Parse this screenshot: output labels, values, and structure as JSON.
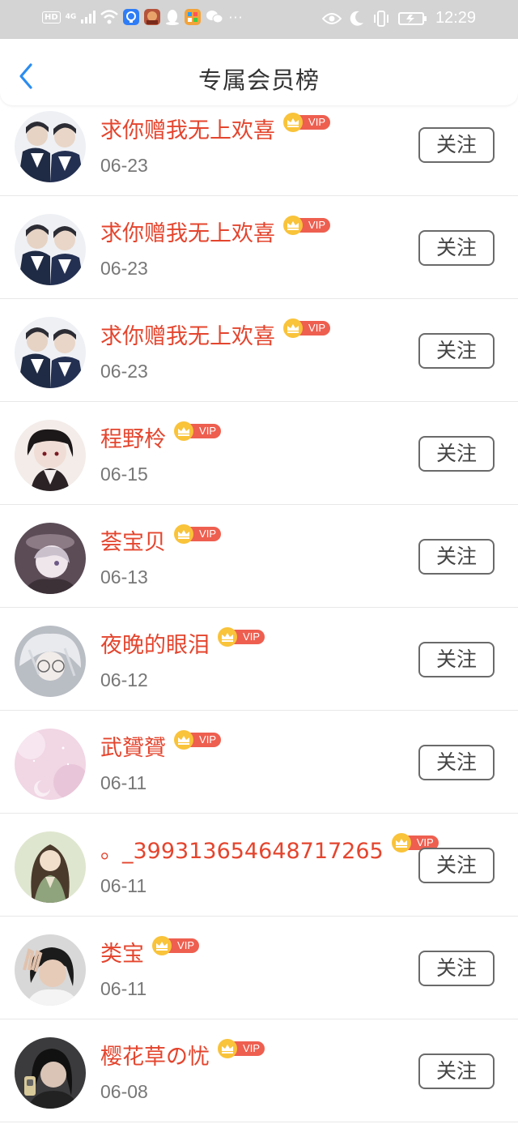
{
  "status_bar": {
    "network_badge": "HD",
    "network_type": "4G",
    "time": "12:29",
    "overflow": "···",
    "icons": [
      "signal-icon",
      "wifi-icon",
      "app-notification-icon",
      "game-app-icon",
      "qq-icon",
      "app-icon",
      "wechat-icon",
      "eye-icon",
      "moon-icon",
      "vibrate-icon",
      "battery-charging-icon"
    ]
  },
  "header": {
    "title": "专属会员榜",
    "back_icon": "chevron-left-icon",
    "accent_color": "#2a8cf0"
  },
  "badge": {
    "label": "VIP",
    "crown_color": "#f9c33a",
    "pill_color": "#ee5f50"
  },
  "colors": {
    "name": "#e4452e",
    "date": "#777777",
    "button_border": "#6a6a6a"
  },
  "members": [
    {
      "name": "求你赠我无上欢喜",
      "date": "06-23",
      "follow_label": "关注",
      "avatar": "avatar-two-boys"
    },
    {
      "name": "求你赠我无上欢喜",
      "date": "06-23",
      "follow_label": "关注",
      "avatar": "avatar-two-boys"
    },
    {
      "name": "求你赠我无上欢喜",
      "date": "06-23",
      "follow_label": "关注",
      "avatar": "avatar-two-boys"
    },
    {
      "name": "程野柃",
      "date": "06-15",
      "follow_label": "关注",
      "avatar": "avatar-dark-anime"
    },
    {
      "name": "荟宝贝",
      "date": "06-13",
      "follow_label": "关注",
      "avatar": "avatar-anime-hat"
    },
    {
      "name": "夜晚的眼泪",
      "date": "06-12",
      "follow_label": "关注",
      "avatar": "avatar-silver-hair"
    },
    {
      "name": "武贇贇",
      "date": "06-11",
      "follow_label": "关注",
      "avatar": "avatar-pink-moon"
    },
    {
      "name": "。_399313654648717265",
      "date": "06-11",
      "follow_label": "关注",
      "avatar": "avatar-ancient-character"
    },
    {
      "name": "类宝",
      "date": "06-11",
      "follow_label": "关注",
      "avatar": "avatar-girl-peace"
    },
    {
      "name": "樱花草の忧",
      "date": "06-08",
      "follow_label": "关注",
      "avatar": "avatar-girl-phone"
    }
  ]
}
